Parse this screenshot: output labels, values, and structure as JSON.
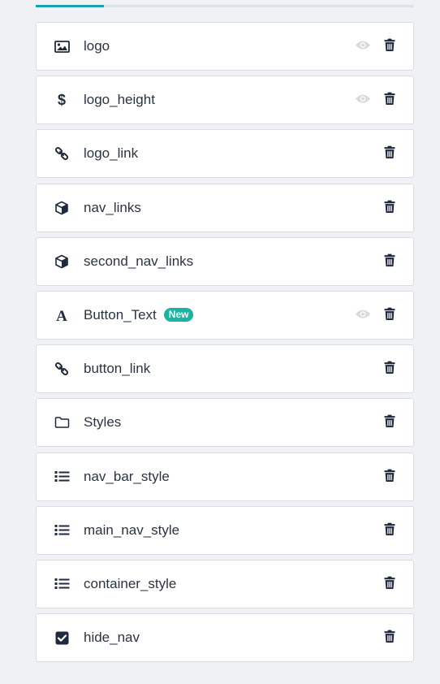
{
  "colors": {
    "background": "#eff1f5",
    "tab_active": "#17a2b8",
    "icon_dark": "#1f2a3c",
    "eye_muted": "#d6d9de",
    "badge": "#1ab3a4"
  },
  "fields": [
    {
      "name": "logo",
      "icon": "image-icon",
      "visibility_toggle": true,
      "badge": ""
    },
    {
      "name": "logo_height",
      "icon": "dollar-icon",
      "visibility_toggle": true,
      "badge": ""
    },
    {
      "name": "logo_link",
      "icon": "link-icon",
      "visibility_toggle": false,
      "badge": ""
    },
    {
      "name": "nav_links",
      "icon": "cube-icon",
      "visibility_toggle": false,
      "badge": ""
    },
    {
      "name": "second_nav_links",
      "icon": "cube-icon",
      "visibility_toggle": false,
      "badge": ""
    },
    {
      "name": "Button_Text",
      "icon": "font-icon",
      "visibility_toggle": true,
      "badge": "New"
    },
    {
      "name": "button_link",
      "icon": "link-icon",
      "visibility_toggle": false,
      "badge": ""
    },
    {
      "name": "Styles",
      "icon": "folder-icon",
      "visibility_toggle": false,
      "badge": ""
    },
    {
      "name": "nav_bar_style",
      "icon": "list-icon",
      "visibility_toggle": false,
      "badge": ""
    },
    {
      "name": "main_nav_style",
      "icon": "list-icon",
      "visibility_toggle": false,
      "badge": ""
    },
    {
      "name": "container_style",
      "icon": "list-icon",
      "visibility_toggle": false,
      "badge": ""
    },
    {
      "name": "hide_nav",
      "icon": "checkbox-icon",
      "visibility_toggle": false,
      "badge": ""
    }
  ]
}
